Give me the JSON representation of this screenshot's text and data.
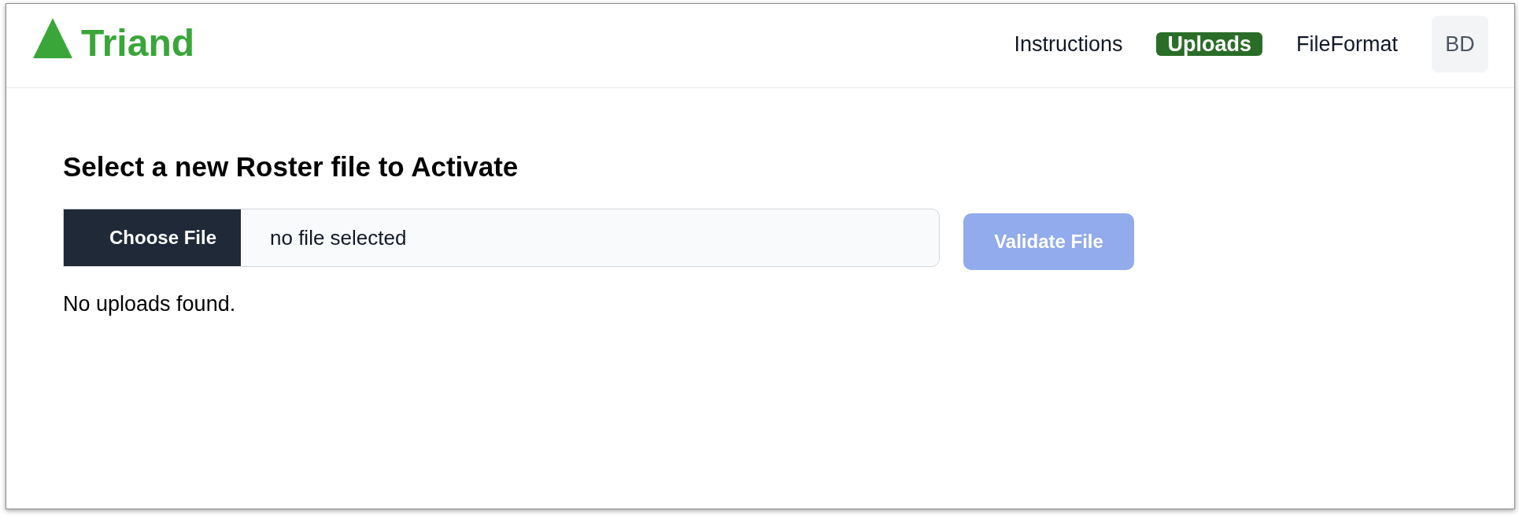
{
  "logo": {
    "text": "Triand"
  },
  "nav": {
    "items": [
      {
        "label": "Instructions",
        "selected": false
      },
      {
        "label": "Uploads",
        "selected": true
      },
      {
        "label": "FileFormat",
        "selected": false
      }
    ],
    "avatar": "BD"
  },
  "upload": {
    "title": "Select a new Roster file to Activate",
    "file_input": {
      "button": "Choose File",
      "status": "no file selected"
    },
    "validate_button": {
      "label": "Validate File",
      "disabled": true
    }
  },
  "uploads_list": {
    "empty_message": "No uploads found."
  }
}
